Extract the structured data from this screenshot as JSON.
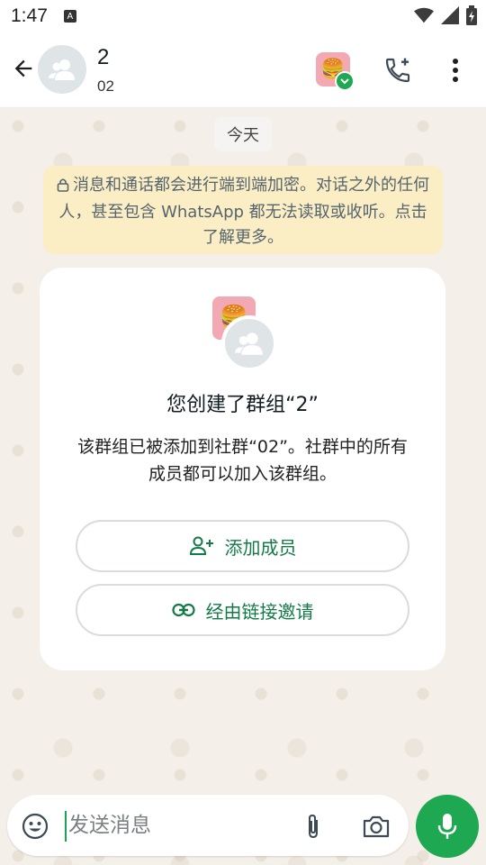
{
  "status_bar": {
    "time": "1:47",
    "a_badge": "A"
  },
  "header": {
    "title": "2",
    "subtitle": "02"
  },
  "chat": {
    "date_chip": "今天",
    "encryption_notice": "消息和通话都会进行端到端加密。对话之外的任何人，甚至包含 WhatsApp 都无法读取或收听。点击了解更多。"
  },
  "card": {
    "title": "您创建了群组“2”",
    "description": "该群组已被添加到社群“02”。社群中的所有成员都可以加入该群组。",
    "add_members_label": "添加成员",
    "invite_link_label": "经由链接邀请"
  },
  "composer": {
    "placeholder": "发送消息"
  },
  "colors": {
    "accent": "#1da851",
    "link_text": "#137b48",
    "notice_bg": "#fbedc4",
    "chat_bg": "#f4efe8"
  },
  "icons": [
    "back-arrow-icon",
    "group-icon",
    "community-icon",
    "check-icon",
    "add-call-icon",
    "more-vert-icon",
    "lock-icon",
    "add-person-icon",
    "link-icon",
    "emoji-icon",
    "attach-icon",
    "camera-icon",
    "mic-icon",
    "wifi-icon",
    "signal-icon",
    "battery-icon"
  ]
}
